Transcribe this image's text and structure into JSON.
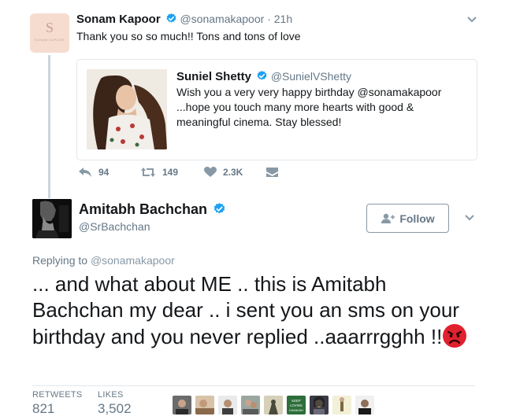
{
  "parent_tweet": {
    "avatar_monogram": "S",
    "avatar_caption": "SONAM KAPOOR",
    "author_name": "Sonam Kapoor",
    "author_handle": "@sonamakapoor",
    "separator": "·",
    "timestamp": "21h",
    "text": "Thank you so so much!! Tons and tons of love",
    "quoted": {
      "author_name": "Suniel Shetty",
      "author_handle": "@SunielVShetty",
      "text": "Wish you a very very happy birthday @sonamakapoor ...hope you touch many more hearts with good & meaningful cinema. Stay blessed!"
    },
    "actions": {
      "replies": "94",
      "retweets": "149",
      "likes": "2.3K"
    }
  },
  "main_tweet": {
    "author_name": "Amitabh Bachchan",
    "author_handle": "@SrBachchan",
    "follow_label": "Follow",
    "replying_prefix": "Replying to",
    "replying_to": "@sonamakapoor",
    "text": "... and what about ME .. this is Amitabh Bachchan my dear .. i sent you an sms on your birthday and you never replied ..aaarrrgghh !!",
    "stats": {
      "retweets_label": "RETWEETS",
      "retweets_value": "821",
      "likes_label": "LIKES",
      "likes_value": "3,502"
    },
    "liker_avatars": [
      "liker-1",
      "liker-2",
      "liker-3",
      "liker-4",
      "liker-5",
      "liker-6",
      "liker-7",
      "liker-8",
      "liker-9"
    ],
    "liker_5_text": "KEEP LOVING DHANUSH"
  },
  "colors": {
    "verified": "#1da1f2",
    "muted": "#657786",
    "divider": "#e1e8ed",
    "angry_face": "#e0212e"
  }
}
